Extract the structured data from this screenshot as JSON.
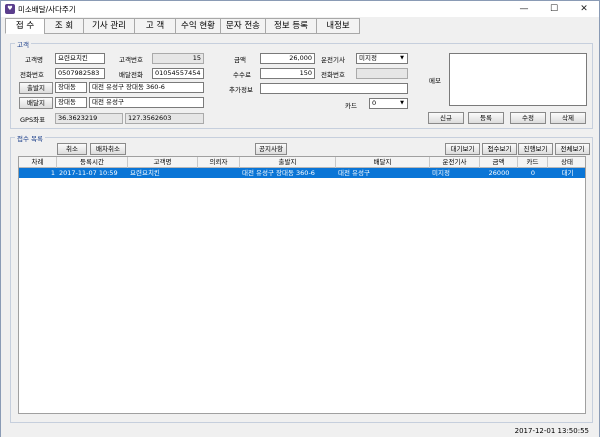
{
  "window": {
    "title": "미소배달/사다주기"
  },
  "tabs": [
    {
      "label": "접 수"
    },
    {
      "label": "조 회"
    },
    {
      "label": "기사 관리"
    },
    {
      "label": "고 객"
    },
    {
      "label": "수익 현황"
    },
    {
      "label": "문자 전송"
    },
    {
      "label": "정보 등록"
    },
    {
      "label": "내정보"
    }
  ],
  "customer": {
    "group_label": "고객",
    "name_label": "고객명",
    "name_value": "요련요치킨",
    "number_label": "고객번호",
    "number_value": "15",
    "phone_label": "전화번호",
    "phone_value": "0507982583",
    "delivery_phone_label": "배달전화",
    "delivery_phone_value": "01054557454",
    "origin_button": "출발지",
    "origin_area": "장대동",
    "origin_address": "대전 유성구 장대동 360-6",
    "dest_button": "배달지",
    "dest_area": "장대동",
    "dest_address": "대전 유성구",
    "gps_label": "GPS좌표",
    "gps_lat": "36.3623219",
    "gps_lng": "127.3562603",
    "amount_label": "금액",
    "amount_value": "26,000",
    "driver_label": "운전기사",
    "driver_value": "미지정",
    "fee_label": "수수료",
    "fee_value": "150",
    "phone_num_label": "전화번호",
    "phone_num_value": "",
    "extra_label": "추가정보",
    "extra_value": "",
    "card_label": "카드",
    "card_value": "0",
    "memo_label": "메모",
    "buttons": {
      "new": "신규",
      "register": "등록",
      "edit": "수정",
      "delete": "삭제"
    }
  },
  "orders": {
    "group_label": "접수 목록",
    "cancel_btn": "취소",
    "assign_cancel_btn": "배차취소",
    "notice_btn": "공지사항",
    "view_buttons": {
      "wait": "대기보기",
      "received": "접수보기",
      "progress": "진행보기",
      "all": "전체보기"
    },
    "columns": [
      "차례",
      "등록시간",
      "고객명",
      "의뢰자",
      "출발지",
      "배달지",
      "운전기사",
      "금액",
      "카드",
      "상태"
    ],
    "rows": [
      {
        "no": "1",
        "time": "2017-11-07 10:59",
        "customer": "요련요치킨",
        "requester": "",
        "origin": "대전 유성구 장대동 360-6",
        "dest": "대전 유성구",
        "driver": "미지정",
        "amount": "26000",
        "card": "0",
        "status": "대기"
      }
    ]
  },
  "status_bar": {
    "datetime": "2017-12-01 13:50:55"
  }
}
